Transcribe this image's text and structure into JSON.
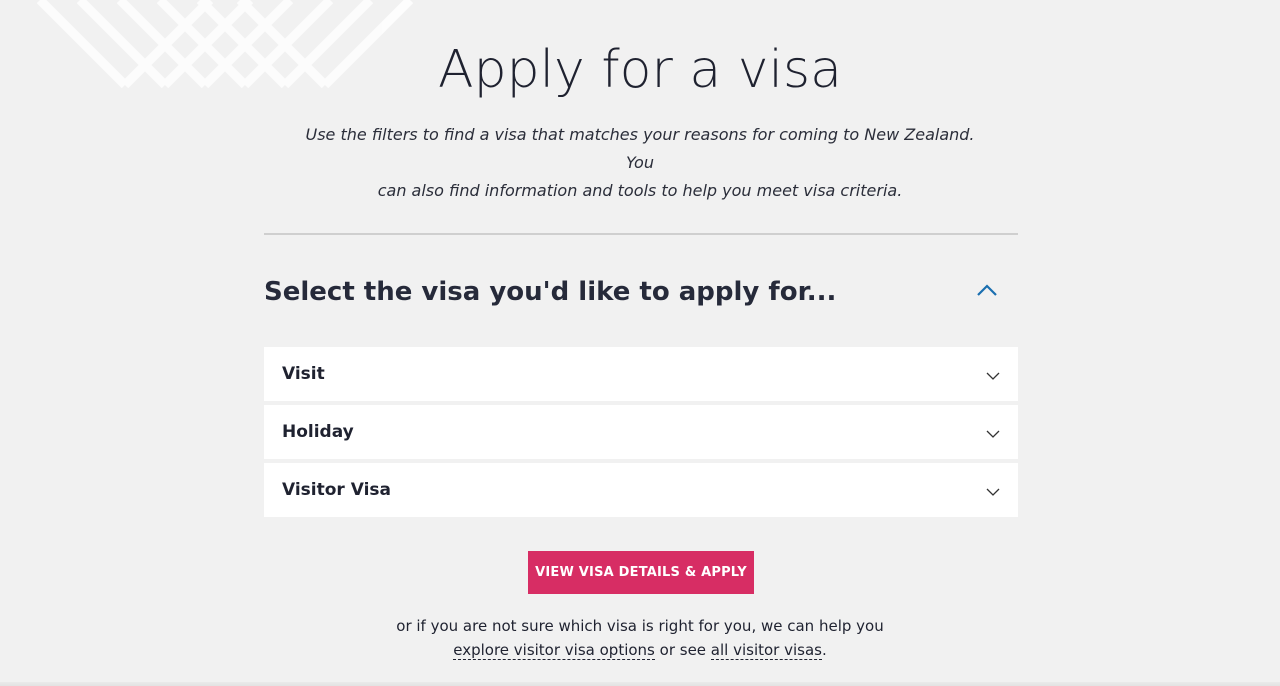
{
  "page": {
    "title": "Apply for a visa",
    "intro_line1": "Use the filters to find a visa that matches your reasons for coming to New Zealand. You",
    "intro_line2": "can also find information and tools to help you meet visa criteria."
  },
  "selector": {
    "heading": "Select the visa you'd like to apply for...",
    "collapse_icon": "chevron-up-icon",
    "items": [
      {
        "label": "Visit",
        "icon": "chevron-down-icon"
      },
      {
        "label": "Holiday",
        "icon": "chevron-down-icon"
      },
      {
        "label": "Visitor Visa",
        "icon": "chevron-down-icon"
      }
    ]
  },
  "cta": {
    "label": "VIEW VISA DETAILS & APPLY",
    "color": "#d72d64"
  },
  "help": {
    "line1": "or if you are not sure which visa is right for you, we can help you",
    "link1": "explore visitor visa options",
    "middle": " or see ",
    "link2": "all visitor visas",
    "end": "."
  },
  "colors": {
    "background": "#f1f1f1",
    "accent_blue": "#1a6fb0",
    "text": "#1f2230"
  }
}
